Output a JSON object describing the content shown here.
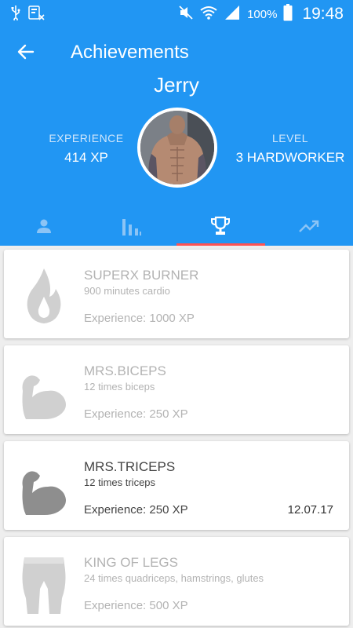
{
  "status_bar": {
    "battery": "100%",
    "time": "19:48"
  },
  "header": {
    "title": "Achievements",
    "user_name": "Jerry",
    "experience_label": "EXPERIENCE",
    "experience_value": "414 XP",
    "level_label": "LEVEL",
    "level_value": "3 HARDWORKER"
  },
  "tabs": [
    {
      "icon": "person-icon",
      "active": false
    },
    {
      "icon": "bar-chart-icon",
      "active": false
    },
    {
      "icon": "trophy-icon",
      "active": true
    },
    {
      "icon": "trending-up-icon",
      "active": false
    }
  ],
  "achievements": [
    {
      "title": "SUPERX BURNER",
      "subtitle": "900 minutes cardio",
      "experience": "Experience: 1000 XP",
      "date": "",
      "unlocked": false,
      "icon": "flame-icon"
    },
    {
      "title": "MRS.BICEPS",
      "subtitle": "12 times biceps",
      "experience": "Experience: 250 XP",
      "date": "",
      "unlocked": false,
      "icon": "biceps-icon"
    },
    {
      "title": "MRS.TRICEPS",
      "subtitle": "12 times triceps",
      "experience": "Experience: 250 XP",
      "date": "12.07.17",
      "unlocked": true,
      "icon": "triceps-icon"
    },
    {
      "title": "KING OF LEGS",
      "subtitle": "24 times quadriceps, hamstrings, glutes",
      "experience": "Experience: 500 XP",
      "date": "",
      "unlocked": false,
      "icon": "legs-icon"
    }
  ],
  "colors": {
    "primary": "#2196f3",
    "tab_indicator": "#ff5252",
    "locked_text": "#b3b3b3"
  }
}
